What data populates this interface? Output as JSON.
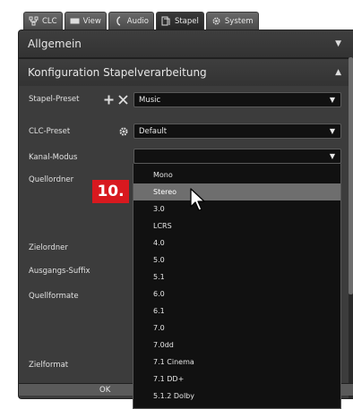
{
  "tabs": [
    {
      "label": "CLC",
      "icon": "network-icon"
    },
    {
      "label": "View",
      "icon": "monitor-icon"
    },
    {
      "label": "Audio",
      "icon": "audio-icon"
    },
    {
      "label": "Stapel",
      "icon": "stack-icon"
    },
    {
      "label": "System",
      "icon": "gear-icon"
    }
  ],
  "active_tab": "Stapel",
  "sections": {
    "general": {
      "title": "Allgemein"
    },
    "batch": {
      "title": "Konfiguration Stapelverarbeitung"
    }
  },
  "fields": {
    "stapel_preset": {
      "label": "Stapel-Preset",
      "value": "Music"
    },
    "clc_preset": {
      "label": "CLC-Preset",
      "value": "Default"
    },
    "kanal_modus": {
      "label": "Kanal-Modus",
      "value": ""
    },
    "quellordner": {
      "label": "Quellordner"
    },
    "zielordner": {
      "label": "Zielordner"
    },
    "ausgangs_suffix": {
      "label": "Ausgangs-Suffix"
    },
    "quellformate": {
      "label": "Quellformate"
    },
    "zielformat": {
      "label": "Zielformat"
    }
  },
  "ok_label": "OK",
  "dropdown": {
    "items": [
      "Mono",
      "Stereo",
      "3.0",
      "LCRS",
      "4.0",
      "5.0",
      "5.1",
      "6.0",
      "6.1",
      "7.0",
      "7.0dd",
      "7.1 Cinema",
      "7.1 DD+",
      "5.1.2 Dolby"
    ],
    "hovered": "Stereo"
  },
  "step_badge": "10.",
  "colors": {
    "accent": "#d8191f",
    "panel": "#3c3c3c",
    "hover": "#6e6e6e"
  }
}
